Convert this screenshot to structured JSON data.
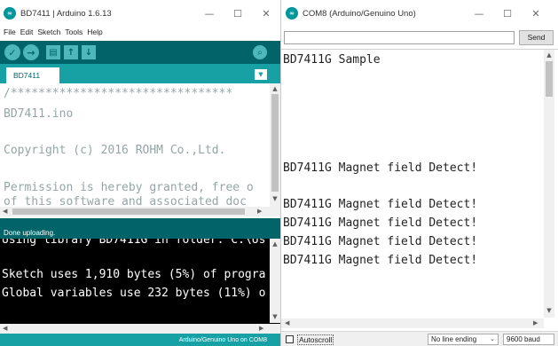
{
  "ide": {
    "title": "BD7411 | Arduino 1.6.13",
    "logo_text": "∞",
    "menu": [
      "File",
      "Edit",
      "Sketch",
      "Tools",
      "Help"
    ],
    "toolbar": {
      "verify_icon": "✓",
      "upload_icon": "→",
      "new_icon": "▤",
      "open_icon": "↑",
      "save_icon": "↓",
      "serial_monitor_icon": "⌕"
    },
    "tab_label": "BD7411",
    "tab_menu_icon": "▼",
    "editor_lines": [
      "/********************************",
      " BD7411.ino",
      "",
      " Copyright (c) 2016 ROHM Co.,Ltd.",
      "",
      " Permission is hereby granted, free o",
      " of this software and associated doc"
    ],
    "status": "Done uploading.",
    "console_lines": [
      "Using library BD7411G in folder: C:\\Us",
      "",
      "Sketch uses 1,910 bytes (5%) of progra",
      "Global variables use 232 bytes (11%) o"
    ],
    "board": "Arduino/Genuino Uno on COM8"
  },
  "window_controls": {
    "minimize": "—",
    "maximize": "☐",
    "close": "✕"
  },
  "monitor": {
    "title": "COM8 (Arduino/Genuino Uno)",
    "logo_text": "∞",
    "input_value": "",
    "send_label": "Send",
    "output_lines": [
      "BD7411G Sample",
      "",
      "",
      "",
      "",
      "BD7411G Magnet field Detect!",
      "",
      "BD7411G Magnet field Detect!",
      "BD7411G Magnet field Detect!",
      "BD7411G Magnet field Detect!",
      "BD7411G Magnet field Detect!"
    ],
    "autoscroll_label": "Autoscroll",
    "autoscroll_checked": false,
    "line_ending": "No line ending",
    "baud": "9600 baud"
  },
  "colors": {
    "teal_dark": "#006468",
    "teal_mid": "#17a1a5",
    "teal_light": "#4db7bb",
    "console_bg": "#000000"
  }
}
